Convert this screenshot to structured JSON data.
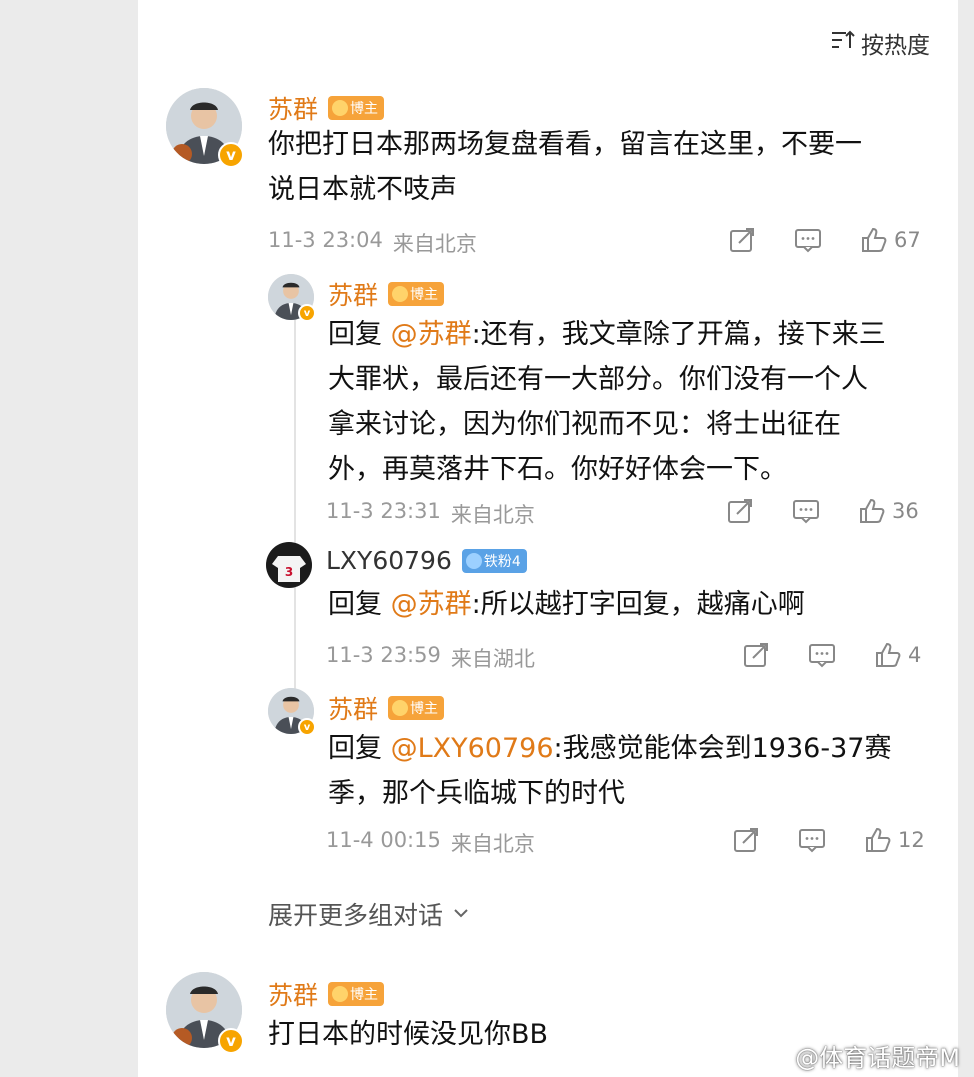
{
  "sort": {
    "label": "按热度",
    "icon": "sort-icon"
  },
  "comments": [
    {
      "name": "苏群",
      "tag": "博主",
      "text_lines": [
        "你把打日本那两场复盘看看，留言在这里，不要一",
        "说日本就不吱声"
      ],
      "time": "11-3 23:04",
      "location": "来自北京",
      "likes": "67"
    }
  ],
  "replies": [
    {
      "name": "苏群",
      "tag": "博主",
      "reply_prefix": "回复 ",
      "reply_to": "@苏群",
      "text_lines": [
        ":还有，我文章除了开篇，接下来三",
        "大罪状，最后还有一大部分。你们没有一个人",
        "拿来讨论，因为你们视而不见：将士出征在",
        "外，再莫落井下石。你好好体会一下。"
      ],
      "time": "11-3 23:31",
      "location": "来自北京",
      "likes": "36"
    },
    {
      "name": "LXY60796",
      "tag": "铁粉4",
      "reply_prefix": "回复 ",
      "reply_to": "@苏群",
      "text_lines": [
        ":所以越打字回复，越痛心啊"
      ],
      "time": "11-3 23:59",
      "location": "来自湖北",
      "likes": "4"
    },
    {
      "name": "苏群",
      "tag": "博主",
      "reply_prefix": "回复 ",
      "reply_to": "@LXY60796",
      "text_lines": [
        ":我感觉能体会到1936-37赛",
        "季，那个兵临城下的时代"
      ],
      "time": "11-4 00:15",
      "location": "来自北京",
      "likes": "12"
    }
  ],
  "expand_label": "展开更多组对话",
  "second_comment": {
    "name": "苏群",
    "tag": "博主",
    "text": "打日本的时候没见你BB"
  },
  "watermark": "@体育话题帝M",
  "colors": {
    "name_orange": "#e07a18",
    "tag_orange": "#f6a33a",
    "tag_blue": "#5aa2e6",
    "meta_gray": "#999999"
  }
}
